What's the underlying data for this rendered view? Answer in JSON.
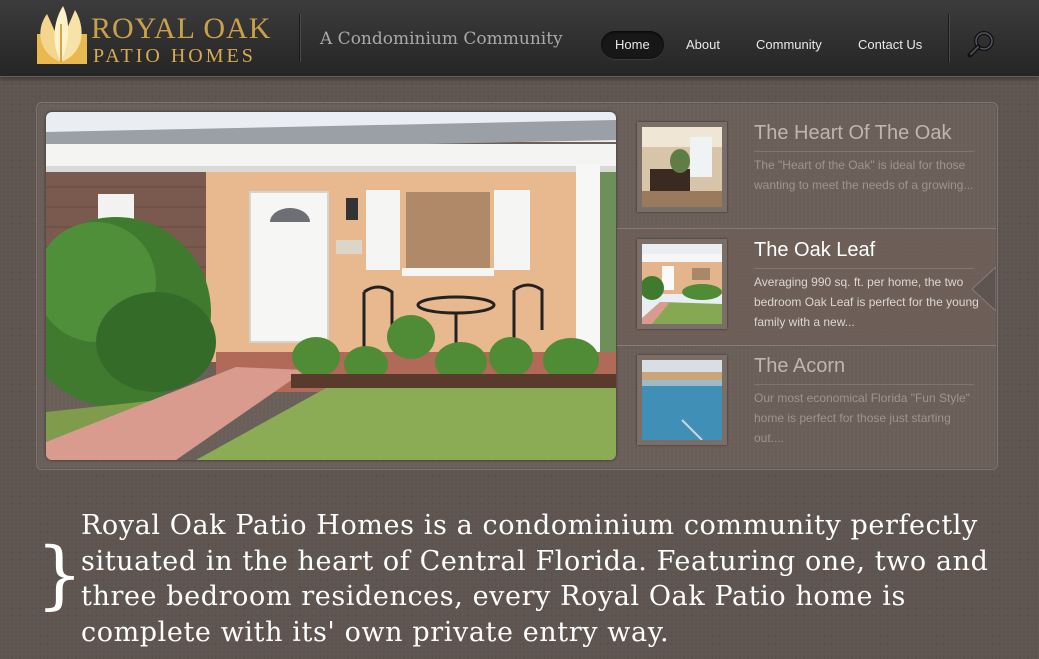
{
  "header": {
    "logo": {
      "line1": "ROYAL  OAK",
      "line2": "PATIO  HOMES"
    },
    "tagline": "A Condominium Community",
    "nav": [
      {
        "label": "Home",
        "active": true
      },
      {
        "label": "About",
        "active": false
      },
      {
        "label": "Community",
        "active": false
      },
      {
        "label": "Contact Us",
        "active": false
      }
    ],
    "search_icon": "magnifier-icon"
  },
  "slider": {
    "items": [
      {
        "title": "The Heart Of The Oak",
        "description": "The \"Heart of the Oak\" is ideal for those wanting to meet the needs of a growing...",
        "active": false
      },
      {
        "title": "The Oak Leaf",
        "description": "Averaging 990 sq. ft. per home, the two bedroom Oak Leaf is perfect for the young family with a new...",
        "active": true
      },
      {
        "title": "The Acorn",
        "description": "Our most economical Florida \"Fun Style\" home is perfect for those just starting out....",
        "active": false
      }
    ]
  },
  "intro": {
    "brace": "}",
    "text": "Royal Oak Patio Homes is a condominium community perfectly situated in the heart of Central Florida. Featuring one, two and three bedroom residences, every Royal Oak Patio home is complete with its' own private entry way."
  },
  "colors": {
    "background": "#5e5450",
    "header": "#2c2c2c",
    "logo_gold": "#c9a14b",
    "active_nav": "#171717"
  }
}
